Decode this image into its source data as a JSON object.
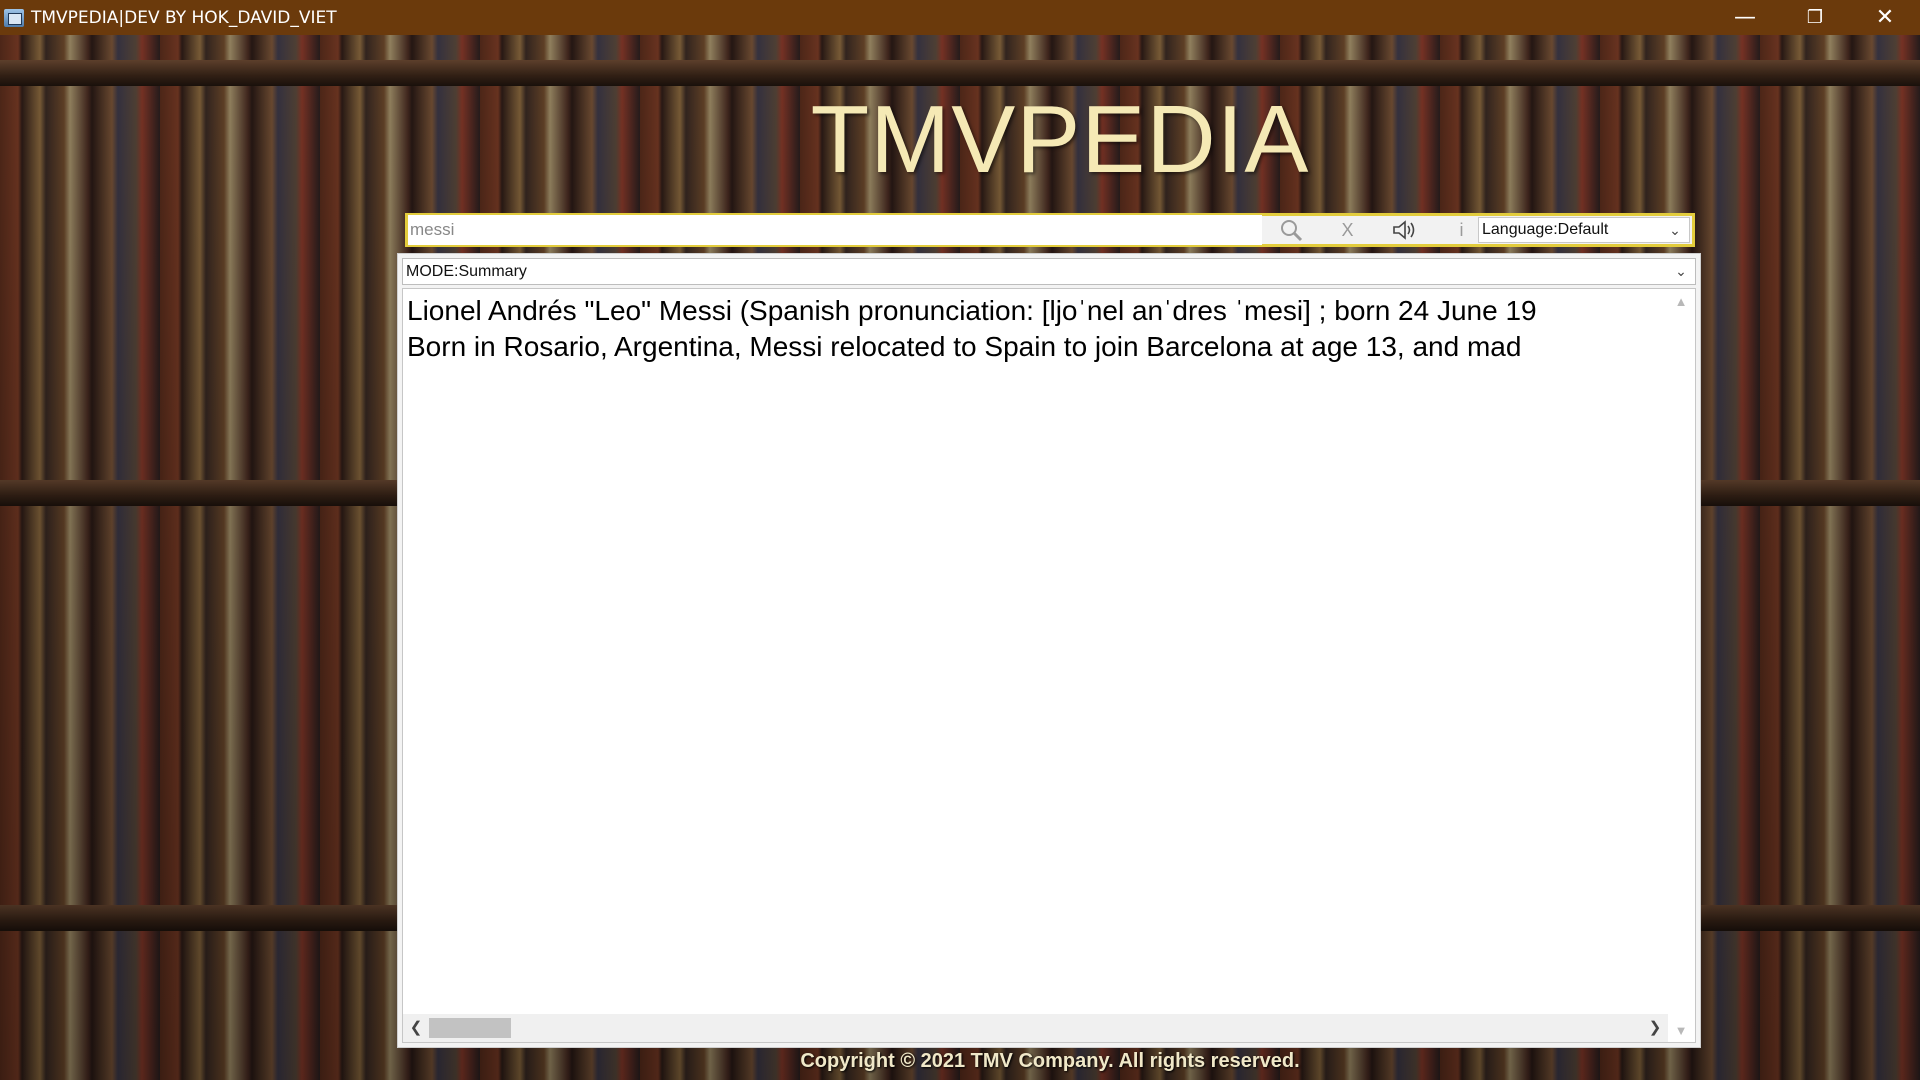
{
  "window": {
    "title": "TMVPEDIA|DEV BY HOK_DAVID_VIET",
    "minimize_glyph": "—",
    "restore_glyph": "❐",
    "close_glyph": "✕"
  },
  "header": {
    "logo_text": "TMVPEDIA"
  },
  "search": {
    "value": "messi",
    "search_icon": "search-icon",
    "clear_label": "X",
    "speaker_icon": "speaker-icon",
    "info_label": "i",
    "language_selected": "Language:Default"
  },
  "mode": {
    "selected": "MODE:Summary"
  },
  "content": {
    "lines": [
      "Lionel Andrés \"Leo\" Messi (Spanish pronunciation: [ljoˈnel anˈdres ˈmesi] ; born 24 June 19",
      "Born in Rosario, Argentina, Messi relocated to Spain to join Barcelona at age 13, and mad"
    ]
  },
  "footer": {
    "copyright": "Copyright © 2021 TMV Company. All rights reserved."
  },
  "colors": {
    "titlebar": "#6b3a0c",
    "logo": "#f5e9b5",
    "search_border": "#e2cc3c"
  }
}
